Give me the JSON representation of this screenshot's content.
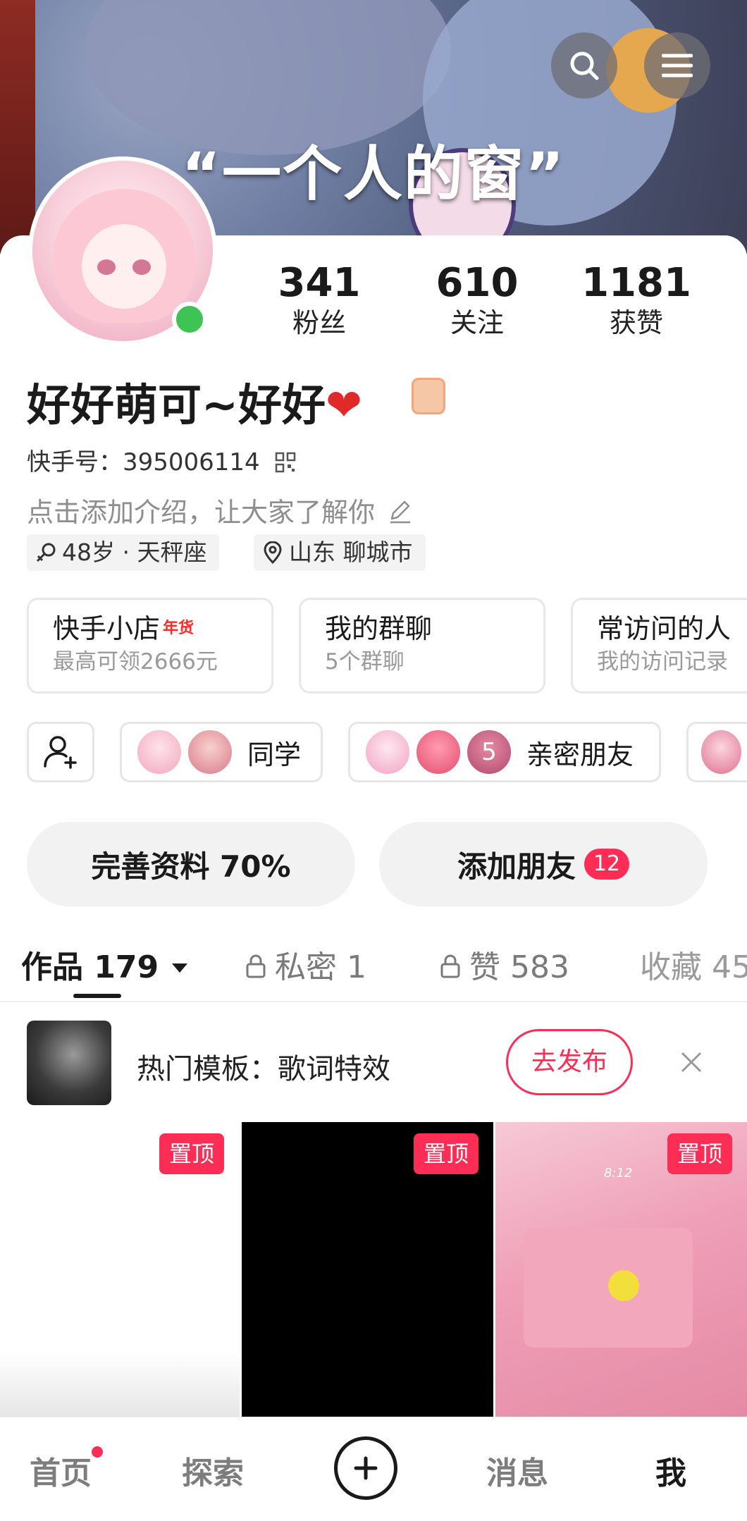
{
  "header": {
    "title": "“一个人的窗”",
    "search_icon": "search-icon",
    "menu_icon": "menu-icon"
  },
  "stats": [
    {
      "value": "341",
      "label": "粉丝"
    },
    {
      "value": "610",
      "label": "关注"
    },
    {
      "value": "1181",
      "label": "获赞"
    }
  ],
  "profile": {
    "nickname": "好好萌可~好好",
    "heart": "❤",
    "kuaishou_id": "快手号：395006114",
    "bio_placeholder": "点击添加介绍，让大家了解你",
    "tags": {
      "age": "48岁 · 天秤座",
      "location": "山东 聊城市"
    }
  },
  "features": [
    {
      "title": "快手小店",
      "badge": "年货",
      "subtitle": "最高可领2666元"
    },
    {
      "title": "我的群聊",
      "subtitle": "5个群聊"
    },
    {
      "title": "常访问的人",
      "subtitle": "我的访问记录"
    }
  ],
  "friend_groups": [
    {
      "label": "同学"
    },
    {
      "label": "亲密朋友",
      "extra_count": "5"
    }
  ],
  "actions": {
    "complete_profile": "完善资料 70%",
    "add_friends": "添加朋友",
    "add_friends_count": "12"
  },
  "tabs": {
    "works": "作品 179",
    "private": "私密 1",
    "liked": "赞 583",
    "favorites": "收藏 45"
  },
  "promo": {
    "text": "热门模板：歌词特效",
    "button": "去发布"
  },
  "grid": {
    "pin_label": "置顶",
    "timestamp": "8:12"
  },
  "bottom_nav": {
    "home": "首页",
    "explore": "探索",
    "messages": "消息",
    "me": "我"
  },
  "colors": {
    "accent": "#fe2d55",
    "online": "#3ec454",
    "text_primary": "#1a1a1a",
    "text_secondary": "#9a9a9a"
  }
}
